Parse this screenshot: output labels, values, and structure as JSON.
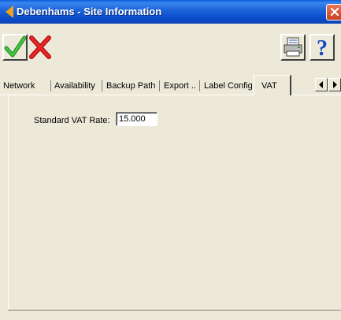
{
  "window": {
    "title": "Debenhams - Site Information"
  },
  "toolbar": {
    "ok_icon": "checkmark-icon",
    "cancel_icon": "red-x-icon",
    "print_icon": "printer-icon",
    "help_icon": "help-question-icon"
  },
  "tabs": [
    {
      "label": "Network"
    },
    {
      "label": "Availability"
    },
    {
      "label": "Backup Path"
    },
    {
      "label": "Export .."
    },
    {
      "label": "Label Config"
    },
    {
      "label": "VAT",
      "active": true
    }
  ],
  "vat": {
    "label": "Standard VAT Rate:",
    "value": "15.000"
  },
  "colors": {
    "titlebar": "#0a4ac8",
    "face": "#ece9d8",
    "check": "#28a428",
    "cross": "#d01010",
    "help": "#1848c0"
  }
}
